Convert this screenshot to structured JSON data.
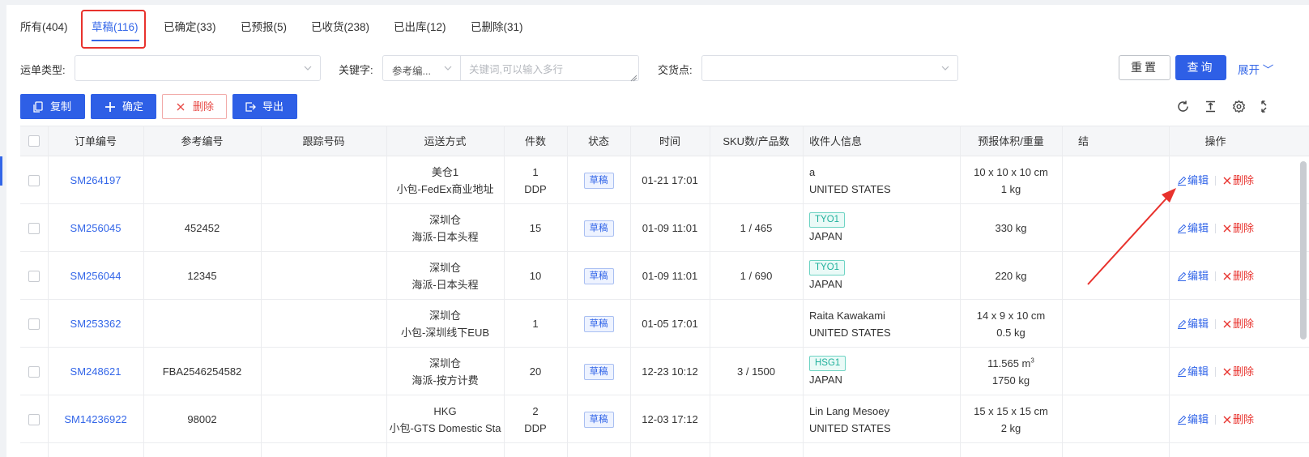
{
  "tabs": [
    {
      "label": "所有(404)"
    },
    {
      "label": "草稿(116)"
    },
    {
      "label": "已确定(33)"
    },
    {
      "label": "已预报(5)"
    },
    {
      "label": "已收货(238)"
    },
    {
      "label": "已出库(12)"
    },
    {
      "label": "已删除(31)"
    }
  ],
  "filters": {
    "waybill_type_label": "运单类型:",
    "keyword_label": "关键字:",
    "keyword_type": "参考编...",
    "keyword_placeholder": "关键词,可以输入多行",
    "delivery_point_label": "交货点:",
    "reset": "重置",
    "query": "查询",
    "expand": "展开"
  },
  "actions": {
    "copy": "复制",
    "confirm": "确定",
    "delete": "删除",
    "export": "导出"
  },
  "table": {
    "headers": {
      "order_no": "订单编号",
      "ref_no": "参考编号",
      "tracking_no": "跟踪号码",
      "shipping": "运送方式",
      "pieces": "件数",
      "status": "状态",
      "time": "时间",
      "sku": "SKU数/产品数",
      "recipient": "收件人信息",
      "volume": "预报体积/重量",
      "extra": "结",
      "ops": "操作"
    },
    "edit_label": "编辑",
    "delete_label": "删除",
    "rows": [
      {
        "order": "SM264197",
        "ref": "",
        "tracking": "",
        "ship1": "美仓1",
        "ship2": "小包-FedEx商业地址",
        "pcs1": "1",
        "pcs2": "DDP",
        "status": "草稿",
        "time": "01-21 17:01",
        "sku": "",
        "zone": "",
        "rcpt1": "a",
        "rcpt2": "UNITED STATES",
        "vol1": "10 x 10 x 10 cm",
        "vol2": "1 kg",
        "vol_sup": ""
      },
      {
        "order": "SM256045",
        "ref": "452452",
        "tracking": "",
        "ship1": "深圳仓",
        "ship2": "海派-日本头程",
        "pcs1": "15",
        "pcs2": "",
        "status": "草稿",
        "time": "01-09 11:01",
        "sku": "1 / 465",
        "zone": "TYO1",
        "rcpt1": "",
        "rcpt2": "JAPAN",
        "vol1": "330 kg",
        "vol2": "",
        "vol_sup": ""
      },
      {
        "order": "SM256044",
        "ref": "12345",
        "tracking": "",
        "ship1": "深圳仓",
        "ship2": "海派-日本头程",
        "pcs1": "10",
        "pcs2": "",
        "status": "草稿",
        "time": "01-09 11:01",
        "sku": "1 / 690",
        "zone": "TYO1",
        "rcpt1": "",
        "rcpt2": "JAPAN",
        "vol1": "220 kg",
        "vol2": "",
        "vol_sup": ""
      },
      {
        "order": "SM253362",
        "ref": "",
        "tracking": "",
        "ship1": "深圳仓",
        "ship2": "小包-深圳线下EUB",
        "pcs1": "1",
        "pcs2": "",
        "status": "草稿",
        "time": "01-05 17:01",
        "sku": "",
        "zone": "",
        "rcpt1": "Raita Kawakami",
        "rcpt2": "UNITED STATES",
        "vol1": "14 x 9 x 10 cm",
        "vol2": "0.5 kg",
        "vol_sup": ""
      },
      {
        "order": "SM248621",
        "ref": "FBA2546254582",
        "tracking": "",
        "ship1": "深圳仓",
        "ship2": "海派-按方计费",
        "pcs1": "20",
        "pcs2": "",
        "status": "草稿",
        "time": "12-23 10:12",
        "sku": "3 / 1500",
        "zone": "HSG1",
        "rcpt1": "",
        "rcpt2": "JAPAN",
        "vol1": "11.565 m",
        "vol2": "1750 kg",
        "vol_sup": "3"
      },
      {
        "order": "SM14236922",
        "ref": "98002",
        "tracking": "",
        "ship1": "HKG",
        "ship2": "小包-GTS Domestic Sta",
        "pcs1": "2",
        "pcs2": "DDP",
        "status": "草稿",
        "time": "12-03 17:12",
        "sku": "",
        "zone": "",
        "rcpt1": "Lin Lang Mesoey",
        "rcpt2": "UNITED STATES",
        "vol1": "15 x 15 x 15 cm",
        "vol2": "2 kg",
        "vol_sup": ""
      }
    ]
  },
  "colors": {
    "primary": "#2e5fe6",
    "danger": "#e8322d",
    "highlight": "#e8322d",
    "zone_badge": "#1fb09b"
  }
}
